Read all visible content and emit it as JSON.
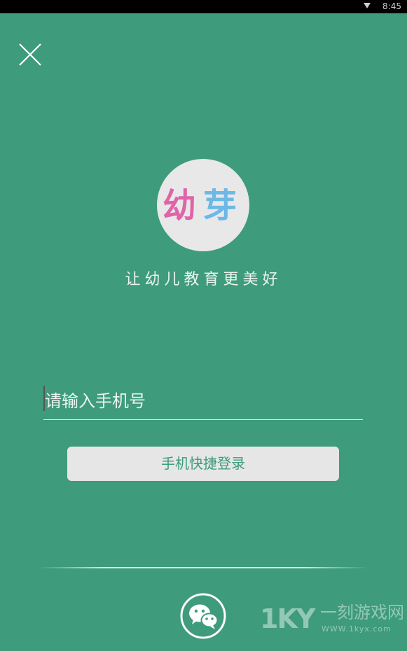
{
  "status_bar": {
    "time": "8:45",
    "signal_icon": "signal-icon"
  },
  "close_icon": "close-icon",
  "logo": {
    "char1": "幼",
    "char2": "芽",
    "colors": {
      "char1": "#e064a8",
      "char2": "#6cb8e6",
      "circle": "#e8e8e8"
    }
  },
  "slogan": "让幼儿教育更美好",
  "phone_input": {
    "value": "",
    "placeholder": "请输入手机号"
  },
  "login_button": {
    "label": "手机快捷登录"
  },
  "wechat_login_icon": "wechat-icon",
  "watermark": {
    "logo_text": "1KY",
    "name": "一刻游戏网",
    "url": "WWW.1kyx.com"
  },
  "theme": {
    "background": "#3e9b7c",
    "button_bg": "#e6e6e6",
    "button_text": "#3e9b7c"
  }
}
